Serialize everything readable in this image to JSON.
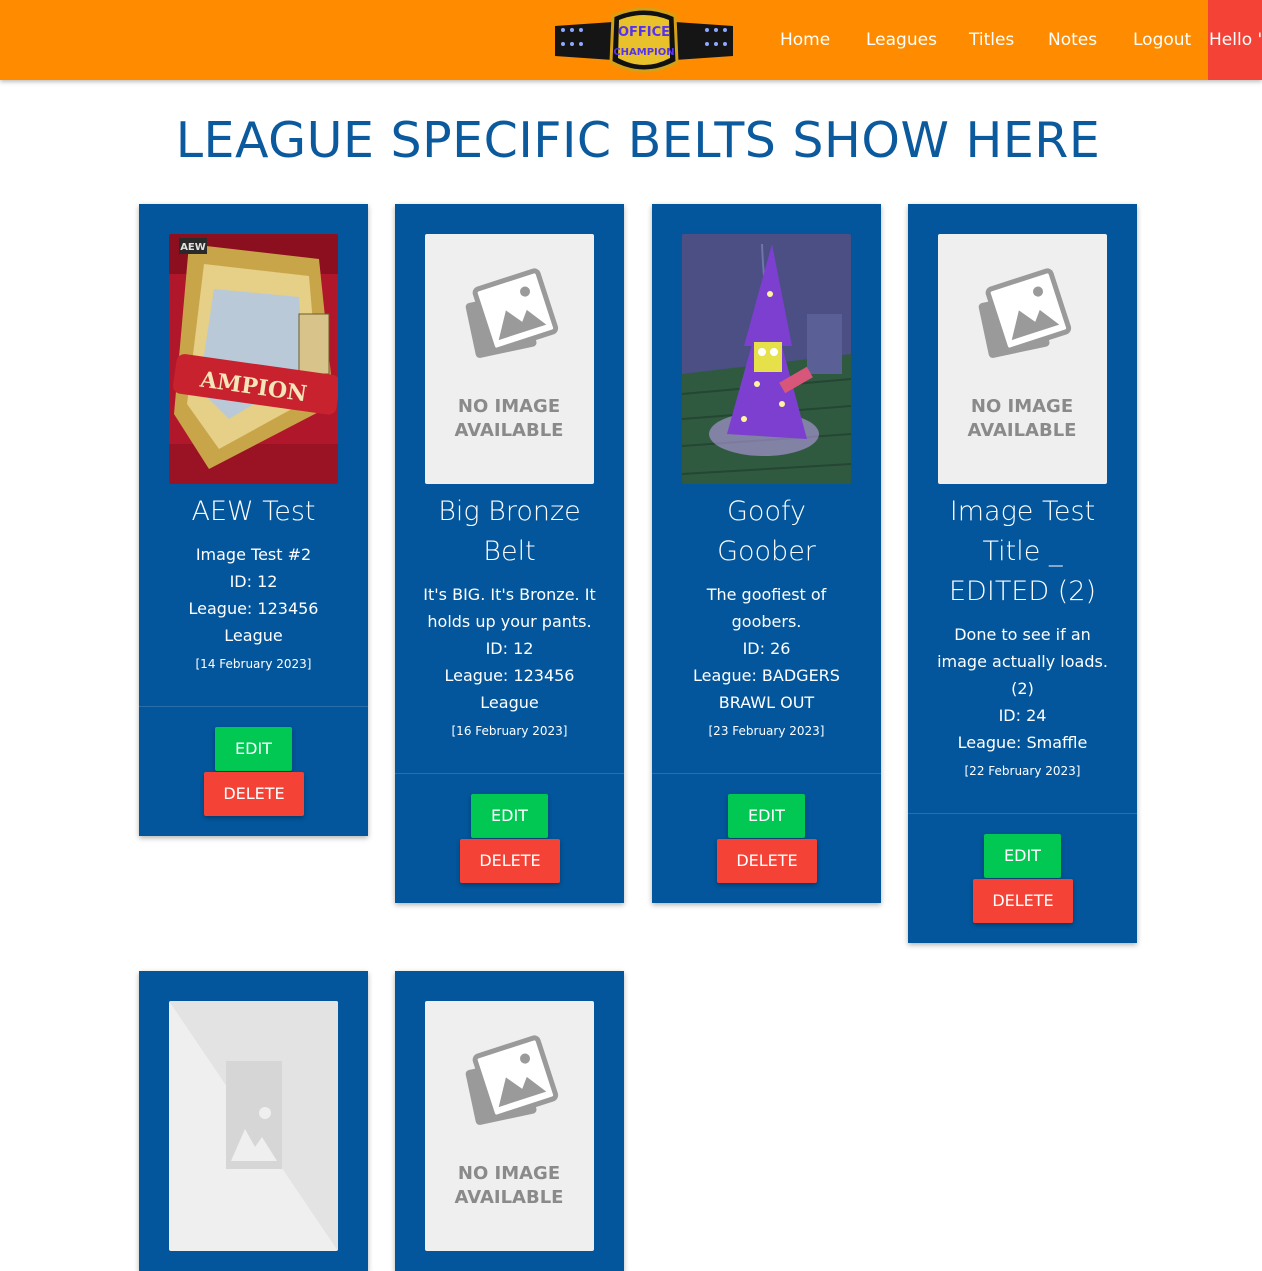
{
  "nav": {
    "logo_text_top": "OFFICE",
    "logo_text_bottom": "CHAMPION",
    "links": [
      "Home",
      "Leagues",
      "Titles",
      "Notes",
      "Logout"
    ],
    "greeting": "Hello \""
  },
  "page": {
    "title": "LEAGUE SPECIFIC BELTS SHOW HERE"
  },
  "placeholder": {
    "line1": "NO IMAGE",
    "line2": "AVAILABLE"
  },
  "cards": [
    {
      "title_lines": [
        "AEW Test"
      ],
      "description_lines": [
        "Image Test #2"
      ],
      "id": "ID: 12",
      "league_lines": [
        "League: 123456",
        "League"
      ],
      "date": "[14 February 2023]",
      "image": "belt-photo",
      "image_label": "AMPION",
      "edit": "EDIT",
      "delete": "DELETE"
    },
    {
      "title_lines": [
        "Big Bronze",
        "Belt"
      ],
      "description_lines": [
        "It's BIG. It's Bronze. It",
        "holds up your pants."
      ],
      "id": "ID: 12",
      "league_lines": [
        "League: 123456",
        "League"
      ],
      "date": "[16 February 2023]",
      "image": "no-image",
      "edit": "EDIT",
      "delete": "DELETE"
    },
    {
      "title_lines": [
        "Goofy",
        "Goober"
      ],
      "description_lines": [
        "The goofiest of",
        "goobers."
      ],
      "id": "ID: 26",
      "league_lines": [
        "League: BADGERS",
        "BRAWL OUT"
      ],
      "date": "[23 February 2023]",
      "image": "cartoon-wizard",
      "edit": "EDIT",
      "delete": "DELETE"
    },
    {
      "title_lines": [
        "Image Test",
        "Title _",
        "EDITED (2)"
      ],
      "description_lines": [
        "Done to see if an",
        "image actually loads.",
        "(2)"
      ],
      "id": "ID: 24",
      "league_lines": [
        "League: Smaffle"
      ],
      "date": "[22 February 2023]",
      "image": "no-image",
      "edit": "EDIT",
      "delete": "DELETE"
    },
    {
      "image": "broken-image"
    },
    {
      "image": "no-image"
    }
  ],
  "colors": {
    "navbar": "#ff8c00",
    "card": "#03569c",
    "title": "#0b5a9e",
    "edit": "#00c853",
    "delete": "#f44336"
  }
}
